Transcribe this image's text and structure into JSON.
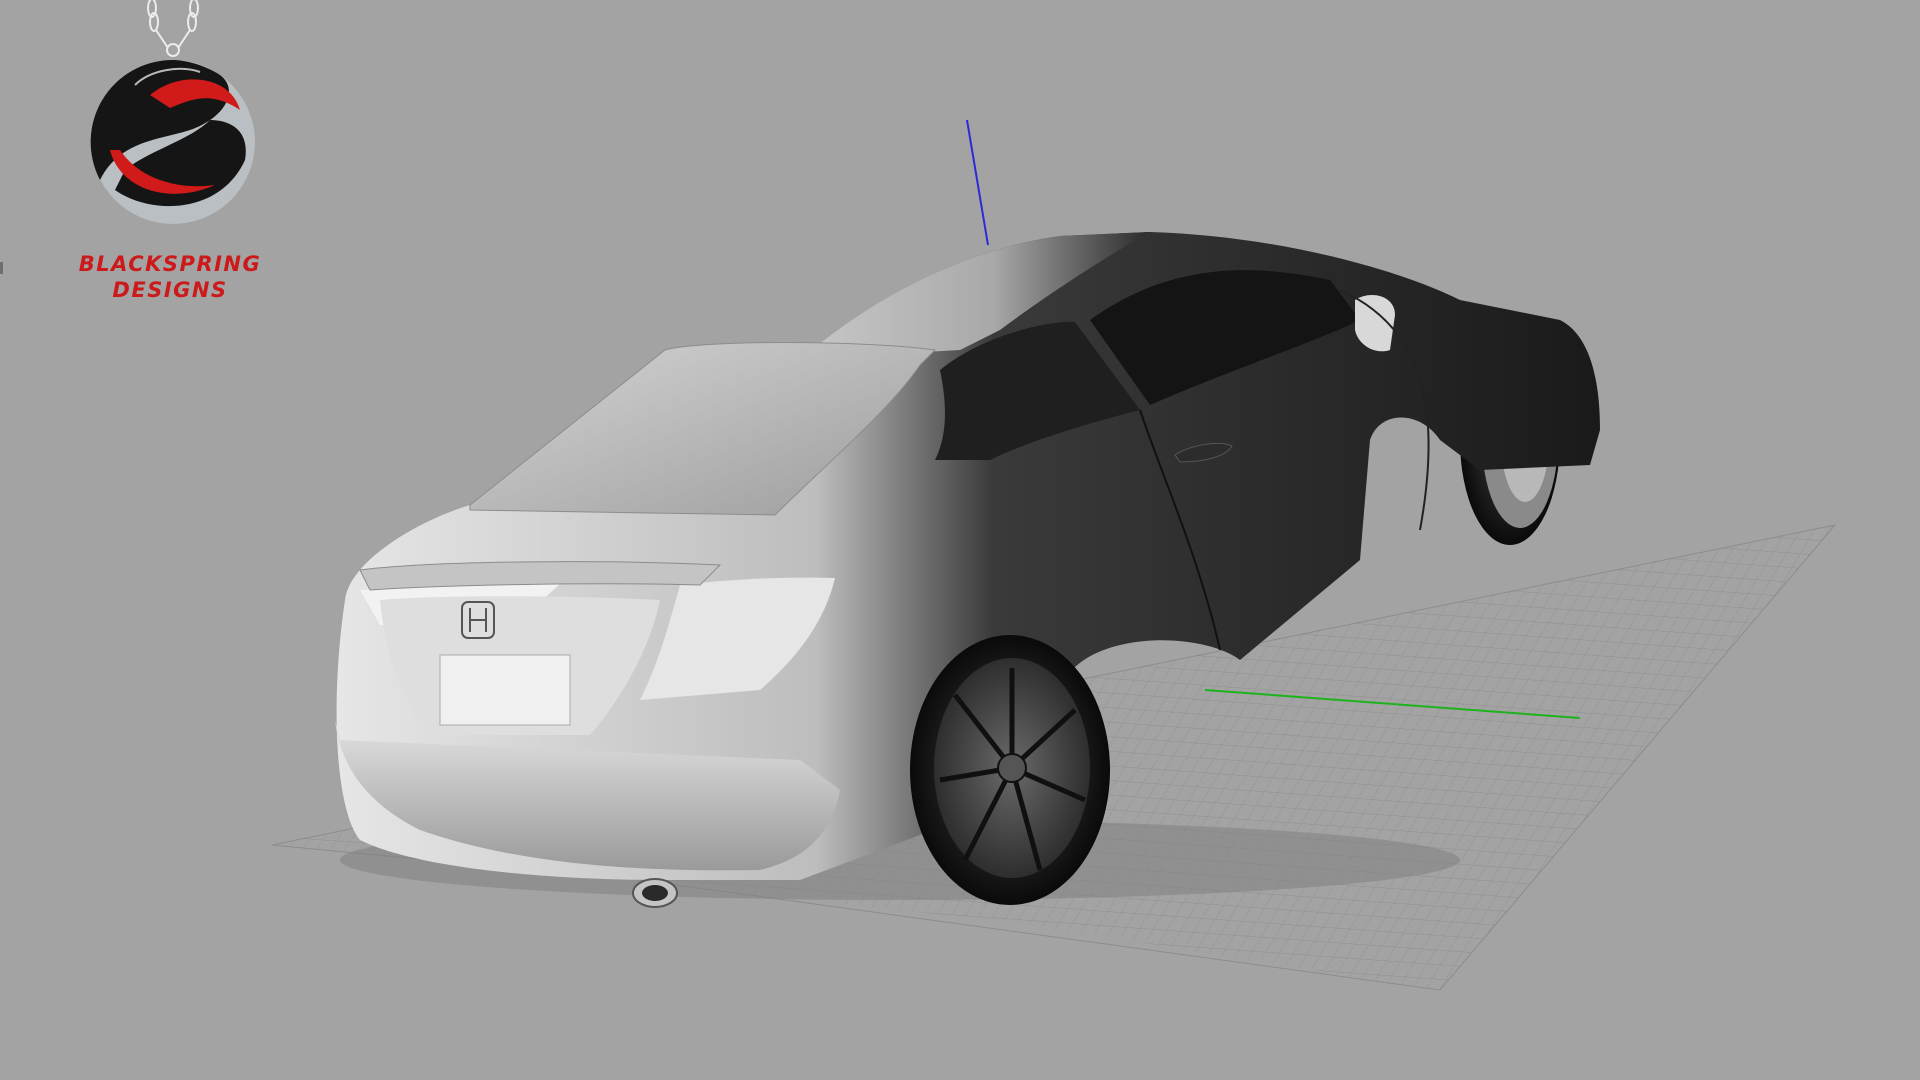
{
  "brand": {
    "line1": "BLACKSPRING",
    "line2": "DESIGNS",
    "logo_icon": "blackspring-pendant-logo",
    "color": "#cc1a1a"
  },
  "viewport": {
    "background": "#a3a3a3",
    "model_subject": "car-3d-model",
    "axis_colors": {
      "x": "#1db31d",
      "z": "#2a2ad6"
    },
    "grid_color": "#7a7a7a"
  }
}
